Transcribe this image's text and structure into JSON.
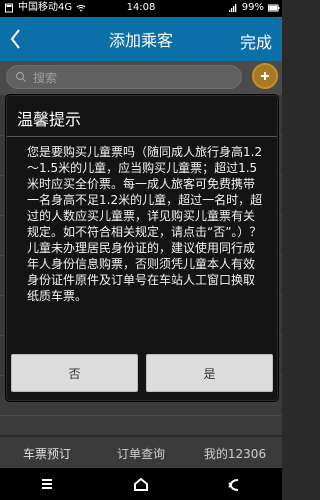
{
  "status_bar": {
    "carrier": "中国移动4G",
    "time": "14:08",
    "battery": "99%"
  },
  "header": {
    "title": "添加乘客",
    "done_label": "完成"
  },
  "search": {
    "placeholder": "搜索"
  },
  "dialog": {
    "title": "温馨提示",
    "body": "您是要购买儿童票吗（随同成人旅行身高1.2～1.5米的儿童，应当购买儿童票；超过1.5米时应买全价票。每一成人旅客可免费携带一名身高不足1.2米的儿童，超过一名时，超过的人数应买儿童票，详见购买儿童票有关规定。如不符合相关规定，请点击“否”。）？\n儿童未办理居民身份证的，建议使用同行成年人身份信息购票，否则须凭儿童本人有效身份证件原件及订单号在车站人工窗口换取纸质车票。",
    "no_label": "否",
    "yes_label": "是"
  },
  "tabs": {
    "ticket": "车票预订",
    "orders": "订单查询",
    "mine": "我的12306"
  }
}
